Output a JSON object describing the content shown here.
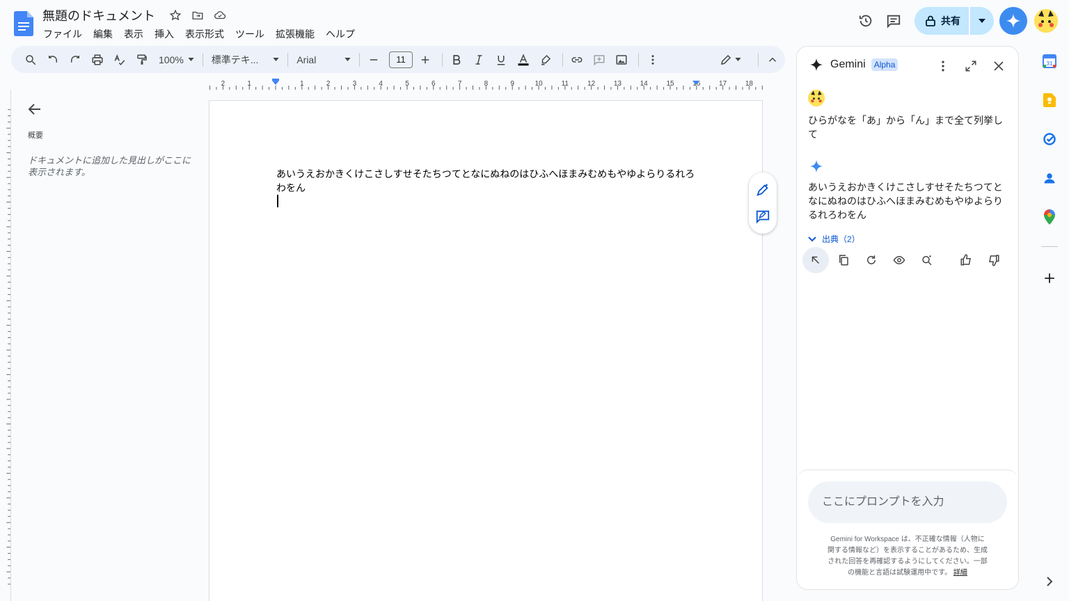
{
  "doc": {
    "title": "無題のドキュメント",
    "menu": [
      "ファイル",
      "編集",
      "表示",
      "挿入",
      "表示形式",
      "ツール",
      "拡張機能",
      "ヘルプ"
    ]
  },
  "header": {
    "share_label": "共有"
  },
  "toolbar": {
    "zoom": "100%",
    "style": "標準テキ...",
    "font": "Arial",
    "font_size": "11"
  },
  "ruler": {
    "labels": [
      "2",
      "1",
      "1",
      "2",
      "3",
      "4",
      "5",
      "6",
      "7",
      "8",
      "9",
      "10",
      "11",
      "12",
      "13",
      "14",
      "15",
      "16",
      "17",
      "18"
    ]
  },
  "outline": {
    "title": "概要",
    "empty_text": "ドキュメントに追加した見出しがここに表示されます。"
  },
  "page": {
    "text": "あいうえおかきくけこさしすせそたちつてとなにぬねのはひふへほまみむめもやゆよらりるれろわをん"
  },
  "gemini": {
    "title": "Gemini",
    "badge": "Alpha",
    "user_message": "ひらがなを「あ」から「ん」まで全て列挙して",
    "response": "あいうえおかきくけこさしすせそたちつてとなにぬねのはひふへほまみむめもやゆよらりるれろわをん",
    "sources_label": "出典（2）",
    "prompt_placeholder": "ここにプロンプトを入力",
    "disclaimer": "Gemini for Workspace は、不正確な情報（人物に関する情報など）を表示することがあるため、生成された回答を再確認するようにしてください。一部の機能と言語は試験運用中です。",
    "disclaimer_link": "詳細"
  },
  "colors": {
    "accent": "#0b57d0",
    "share_bg": "#c2e7ff",
    "toolbar_bg": "#edf2fa"
  }
}
